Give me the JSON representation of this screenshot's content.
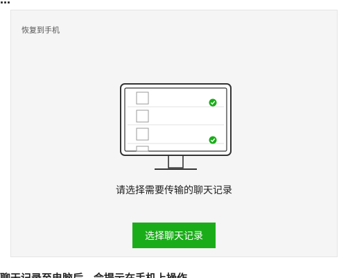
{
  "top_text": "…",
  "panel": {
    "title": "恢复到手机",
    "prompt": "请选择需要传输的聊天记录",
    "select_button": "选择聊天记录"
  },
  "bottom_text": "聊天记录至电脑后，会提示在手机上操作",
  "colors": {
    "accent": "#1aad19",
    "panel_bg": "#f5f5f5"
  },
  "illustration": {
    "icon": "monitor-icon",
    "rows": [
      {
        "checked": true
      },
      {
        "checked": false
      },
      {
        "checked": true
      },
      {
        "checked": false
      }
    ]
  }
}
